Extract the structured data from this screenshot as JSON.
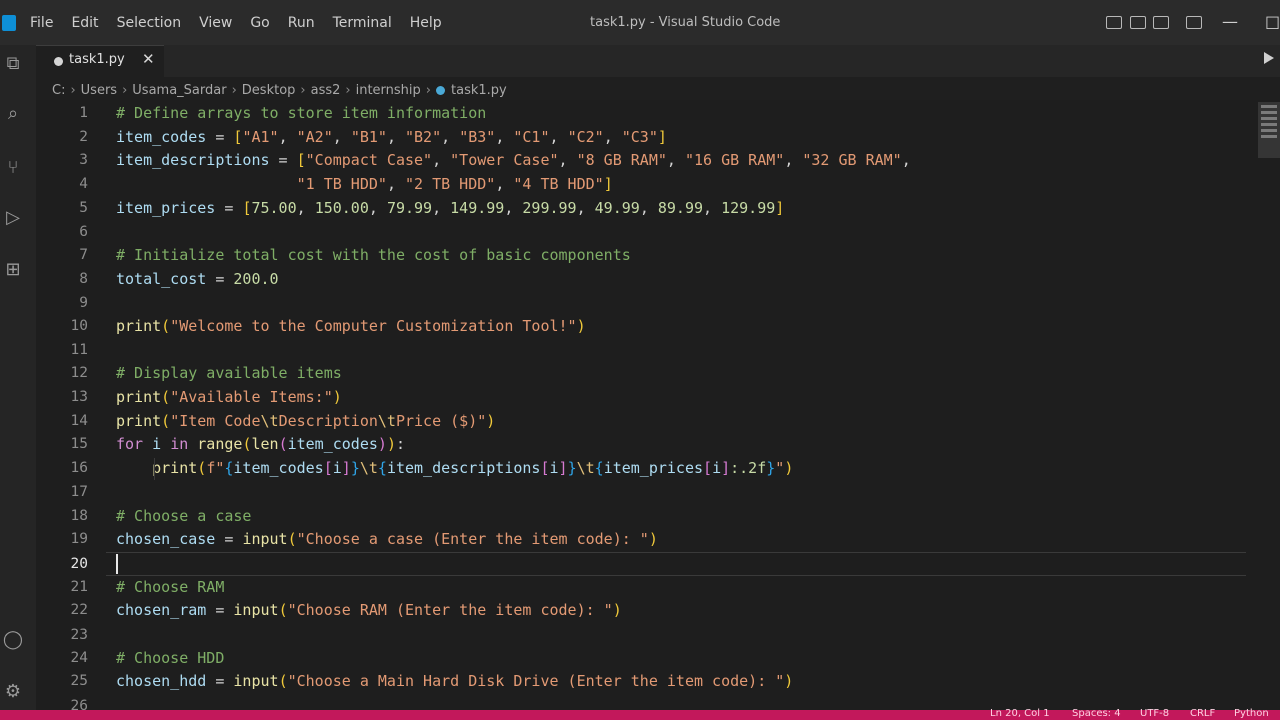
{
  "titlebar": {
    "menus": [
      "File",
      "Edit",
      "Selection",
      "View",
      "Go",
      "Run",
      "Terminal",
      "Help"
    ],
    "window_title": "task1.py - Visual Studio Code"
  },
  "activity_icons": [
    "explorer-icon",
    "search-icon",
    "source-control-icon",
    "run-debug-icon",
    "extensions-icon",
    "account-icon",
    "settings-gear-icon"
  ],
  "tab": {
    "label": "task1.py",
    "close": "✕"
  },
  "breadcrumb": [
    "C:",
    "Users",
    "Usama_Sardar",
    "Desktop",
    "ass2",
    "internship",
    "task1.py"
  ],
  "editor": {
    "current_line": 20,
    "lines": [
      {
        "n": "1"
      },
      {
        "n": "2"
      },
      {
        "n": "3"
      },
      {
        "n": "4"
      },
      {
        "n": "5"
      },
      {
        "n": "6"
      },
      {
        "n": "7"
      },
      {
        "n": "8"
      },
      {
        "n": "9"
      },
      {
        "n": "10"
      },
      {
        "n": "11"
      },
      {
        "n": "12"
      },
      {
        "n": "13"
      },
      {
        "n": "14"
      },
      {
        "n": "15"
      },
      {
        "n": "16"
      },
      {
        "n": "17"
      },
      {
        "n": "18"
      },
      {
        "n": "19"
      },
      {
        "n": "20"
      },
      {
        "n": "21"
      },
      {
        "n": "22"
      },
      {
        "n": "23"
      },
      {
        "n": "24"
      },
      {
        "n": "25"
      },
      {
        "n": "26"
      }
    ]
  },
  "status": {
    "position": "Ln 20, Col 1",
    "spaces": "Spaces: 4",
    "encoding": "UTF-8",
    "eol": "CRLF",
    "language": "Python"
  }
}
